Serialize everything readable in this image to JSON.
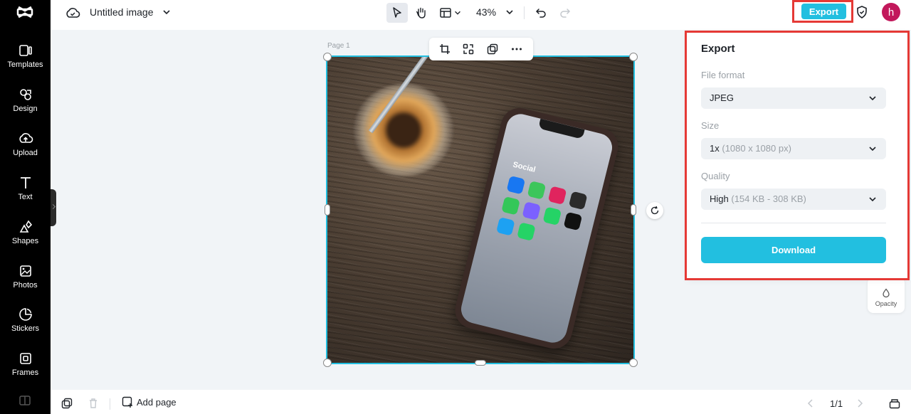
{
  "sidebar": {
    "items": [
      {
        "label": "Templates",
        "icon": "templates-icon"
      },
      {
        "label": "Design",
        "icon": "design-icon"
      },
      {
        "label": "Upload",
        "icon": "upload-icon"
      },
      {
        "label": "Text",
        "icon": "text-icon"
      },
      {
        "label": "Shapes",
        "icon": "shapes-icon"
      },
      {
        "label": "Photos",
        "icon": "photos-icon"
      },
      {
        "label": "Stickers",
        "icon": "stickers-icon"
      },
      {
        "label": "Frames",
        "icon": "frames-icon"
      }
    ]
  },
  "topbar": {
    "title": "Untitled image",
    "zoom": "43%",
    "export_label": "Export",
    "avatar_initial": "h"
  },
  "canvas": {
    "page_label": "Page 1",
    "photo": {
      "folder_label": "Social",
      "app_colors": [
        "#1877f2",
        "#3cc65b",
        "#e0245e",
        "#2b2b2b",
        "#34c759",
        "#7b61ff",
        "#25d366",
        "#111111",
        "#1da1f2",
        "#25d366"
      ]
    }
  },
  "export_panel": {
    "title": "Export",
    "file_format_label": "File format",
    "file_format_value": "JPEG",
    "size_label": "Size",
    "size_value": "1x",
    "size_hint": "(1080 x 1080 px)",
    "quality_label": "Quality",
    "quality_value": "High",
    "quality_hint": "(154 KB - 308 KB)",
    "download_label": "Download"
  },
  "right_panel": {
    "opacity_label": "Opacity"
  },
  "bottombar": {
    "add_page_label": "Add page",
    "page_indicator": "1/1"
  },
  "colors": {
    "accent": "#22bfe0",
    "highlight": "#e53935",
    "avatar": "#c2185b"
  }
}
